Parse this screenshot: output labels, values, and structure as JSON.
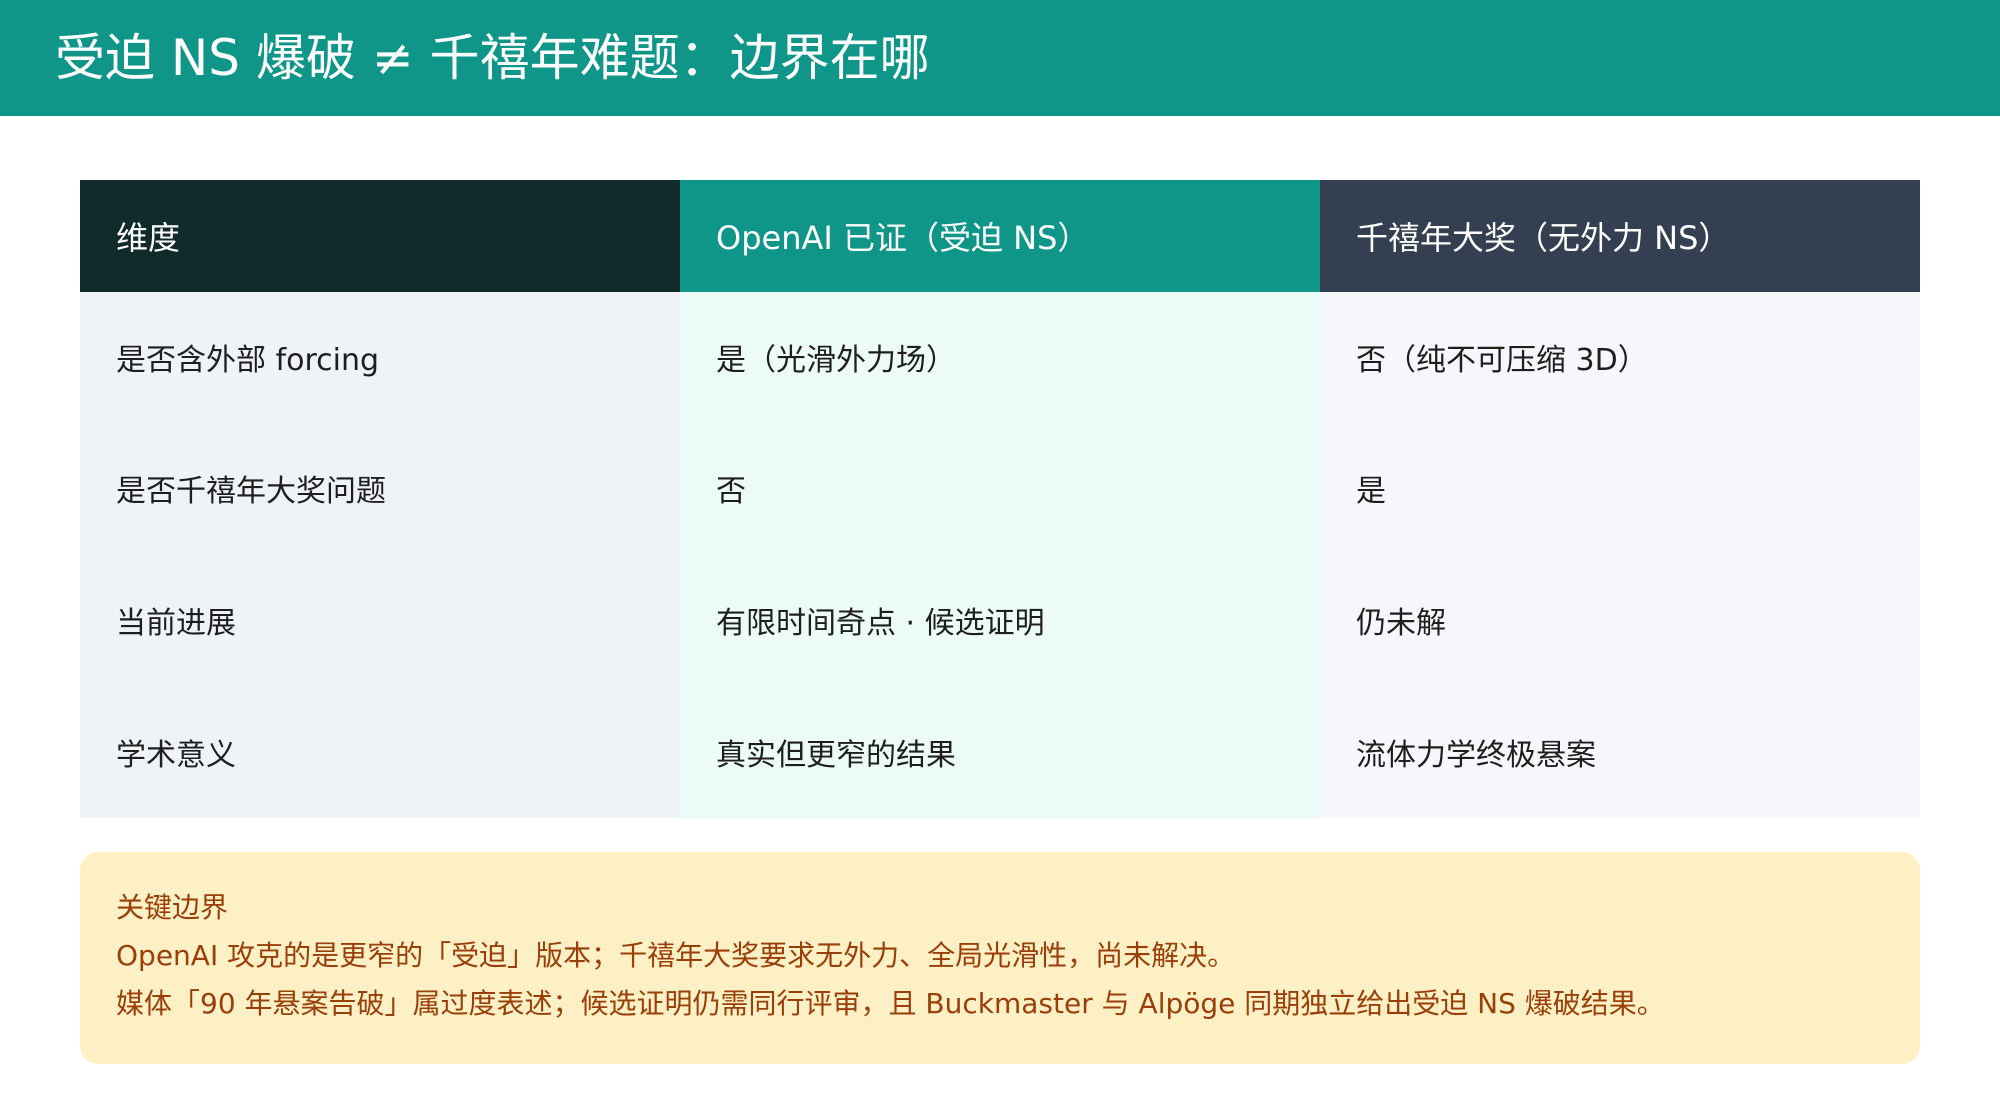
{
  "header": {
    "title": "受迫 NS 爆破 ≠ 千禧年难题：边界在哪"
  },
  "table": {
    "columns": [
      "维度",
      "OpenAI 已证（受迫 NS）",
      "千禧年大奖（无外力 NS）"
    ],
    "rows": [
      [
        "是否含外部 forcing",
        "是（光滑外力场）",
        "否（纯不可压缩 3D）"
      ],
      [
        "是否千禧年大奖问题",
        "否",
        "是"
      ],
      [
        "当前进展",
        "有限时间奇点 · 候选证明",
        "仍未解"
      ],
      [
        "学术意义",
        "真实但更窄的结果",
        "流体力学终极悬案"
      ]
    ]
  },
  "callout": {
    "title": "关键边界",
    "lines": [
      "OpenAI 攻克的是更窄的「受迫」版本；千禧年大奖要求无外力、全局光滑性，尚未解决。",
      "媒体「90 年悬案告破」属过度表述；候选证明仍需同行评审，且 Buckmaster 与 Alpöge 同期独立给出受迫 NS 爆破结果。"
    ]
  },
  "colors": {
    "header_bg": "#0f9688",
    "col1_header_bg": "#112a2a",
    "col2_header_bg": "#0f9688",
    "col3_header_bg": "#343f51",
    "callout_bg": "#fdf0c4",
    "callout_text": "#9a3e0a"
  }
}
